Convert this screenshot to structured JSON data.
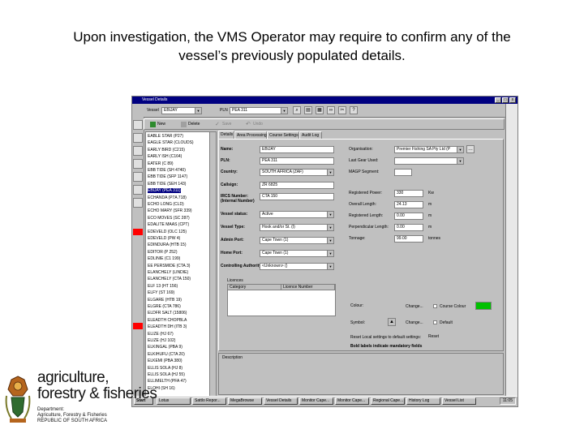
{
  "caption": {
    "line1": "Upon investigation, the VMS Operator may require to confirm any of the",
    "line2": "vessel’s previously populated details."
  },
  "window": {
    "title": "Vessel Details",
    "controls": [
      "_",
      "□",
      "x"
    ]
  },
  "toolbar": {
    "vessel_label": "Vessel",
    "vessel_value": "EBIJAY",
    "pln_label": "PLN",
    "pln_value": "PEA 311"
  },
  "actions": {
    "new": "New",
    "delete": "Delete",
    "save": "Save",
    "undo": "Undo"
  },
  "tree": {
    "items": [
      "EABLE STAR (P27)",
      "EAGLE STAR (CLOUDS)",
      "EARLY BIRD (C215)",
      "EARLY ISH (C164)",
      "EATER (C 89)",
      "EBB TIDE (SH 4740)",
      "EBB TIDE (SFP 1147)",
      "EBB TIDE (SEH 143)",
      "EBIJAY (PEA 311)",
      "ECHANDA (P7A 718)",
      "ECHO LONG (CLD)",
      "ECHO MARY (SFR 339)",
      "ECO MOVES (SC 287)",
      "EDALITE MAAS (CPT)",
      "EDEVELD (OLC 125)",
      "EDEVELD (PW 4)",
      "EDINDURA (HTB 15)",
      "EDITOR (P 252)",
      "EDLINIE (C1 199)",
      "EE PERSMIDE (CTA 3)",
      "ELANCHELY (LINDIE)",
      "ELANCHELY (CTA 150)",
      "ELF 13 (HT 156)",
      "ELFY (ST 169)",
      "ELGARE (HTB 19)",
      "ELGRE (CTA 786)",
      "ELDFR SALT (15806)",
      "ELEADTH CHOPBLA",
      "ELEADTH DH (ITB 3)",
      "ELIZE (HJ 67)",
      "ELIZE (HJ 102)",
      "ELKINGAL (PBA 9)",
      "ELKIHUFU (CTA 20)",
      "ELKEMI (PBA 380)",
      "ELLIS SOLA (HJ 8)",
      "ELLIS SOLA (HJ 55)",
      "ELLIMELTH (PFA 47)",
      "ELOHI (SH 16)"
    ],
    "selected_index": 8
  },
  "tabs": [
    "Details",
    "Area Processing",
    "Course Settings",
    "Audit Log"
  ],
  "form": {
    "left": [
      {
        "label": "Name:",
        "value": "EBIJAY",
        "type": "text"
      },
      {
        "label": "PLN:",
        "value": "PEA 311",
        "type": "text"
      },
      {
        "label": "Country:",
        "value": "SOUTH AFRICA (ZAF)",
        "type": "select"
      },
      {
        "label": "Callsign:",
        "value": "ZR 6825",
        "type": "text"
      },
      {
        "label": "IRCS Number:",
        "label2": "(Internal Number)",
        "value": "CTA 150",
        "type": "text"
      },
      {
        "label": "Vessel status:",
        "value": "Active",
        "type": "select"
      },
      {
        "label": "Vessel Type:",
        "value": "Hook and/or St. (I)",
        "type": "select"
      },
      {
        "label": "Admin Port:",
        "value": "Cape Town (1)",
        "type": "select"
      },
      {
        "label": "Home Port:",
        "value": "Cape Town (1)",
        "type": "select"
      },
      {
        "label": "Controlling Authority:",
        "value": "<Unknown> ()",
        "type": "select"
      }
    ],
    "right": [
      {
        "label": "Organisation:",
        "value": "Premier Fishing SA Pty Ltd (P",
        "type": "select"
      },
      {
        "label": "Last Gear Used:",
        "value": "",
        "type": "select"
      },
      {
        "label": "MAGP Segment:",
        "value": "",
        "type": "text"
      },
      {
        "label": "Registered Power:",
        "value": "330",
        "unit": "Kw",
        "type": "text"
      },
      {
        "label": "Overall Length:",
        "value": "24.13",
        "unit": "m",
        "type": "text"
      },
      {
        "label": "Registered Length:",
        "value": "0.00",
        "unit": "m",
        "type": "text"
      },
      {
        "label": "Perpendicular Length:",
        "value": "0.00",
        "unit": "m",
        "type": "text"
      },
      {
        "label": "Tonnage:",
        "value": "99.00",
        "unit": "tonnes",
        "type": "text"
      }
    ],
    "licences_label": "Licences",
    "licence_cols": [
      "Category",
      "Licence Number"
    ],
    "colour_label": "Colour:",
    "colour_value": "#00c000",
    "change_label": "Change...",
    "symbol_label": "Symbol:",
    "course_colour_label": "Course Colour",
    "default_label": "Default",
    "reset_note": "Reset Local settings to default settings:",
    "reset_button": "Reset",
    "mandatory_note": "Bold labels indicate mandatory fields"
  },
  "description_label": "Description",
  "taskbar": {
    "start": "Start",
    "tasks": [
      "Lotus",
      "Sattlo Repor...",
      "MegaBrowse",
      "Vessel Details",
      "Monitor Cape...",
      "Monitor Cape...",
      "Regional Cape...",
      "History Log",
      "Vessel List"
    ],
    "clock": "11:05"
  },
  "logo": {
    "brand_line1": "agriculture,",
    "brand_line2": "forestry & fisheries",
    "dept_line1": "Department:",
    "dept_line2": "Agriculture, Forestry & Fisheries",
    "dept_line3": "REPUBLIC OF SOUTH AFRICA"
  }
}
